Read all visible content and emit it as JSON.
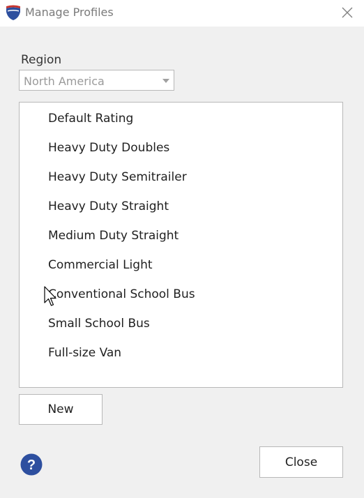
{
  "window": {
    "title": "Manage Profiles",
    "icon": "app-shield-icon",
    "close_icon": "close-icon"
  },
  "region": {
    "label": "Region",
    "selected": "North America"
  },
  "profiles": [
    "Default Rating",
    "Heavy Duty Doubles",
    "Heavy Duty Semitrailer",
    "Heavy Duty Straight",
    "Medium Duty Straight",
    "Commercial Light",
    "Conventional School Bus",
    "Small School Bus",
    "Full-size Van"
  ],
  "buttons": {
    "new_label": "New",
    "close_label": "Close"
  },
  "help": {
    "glyph": "?"
  },
  "colors": {
    "dialog_bg": "#f0f0f0",
    "help_blue": "#2d4f9f",
    "logo_red": "#c8352f",
    "logo_blue": "#2d4f9f"
  }
}
